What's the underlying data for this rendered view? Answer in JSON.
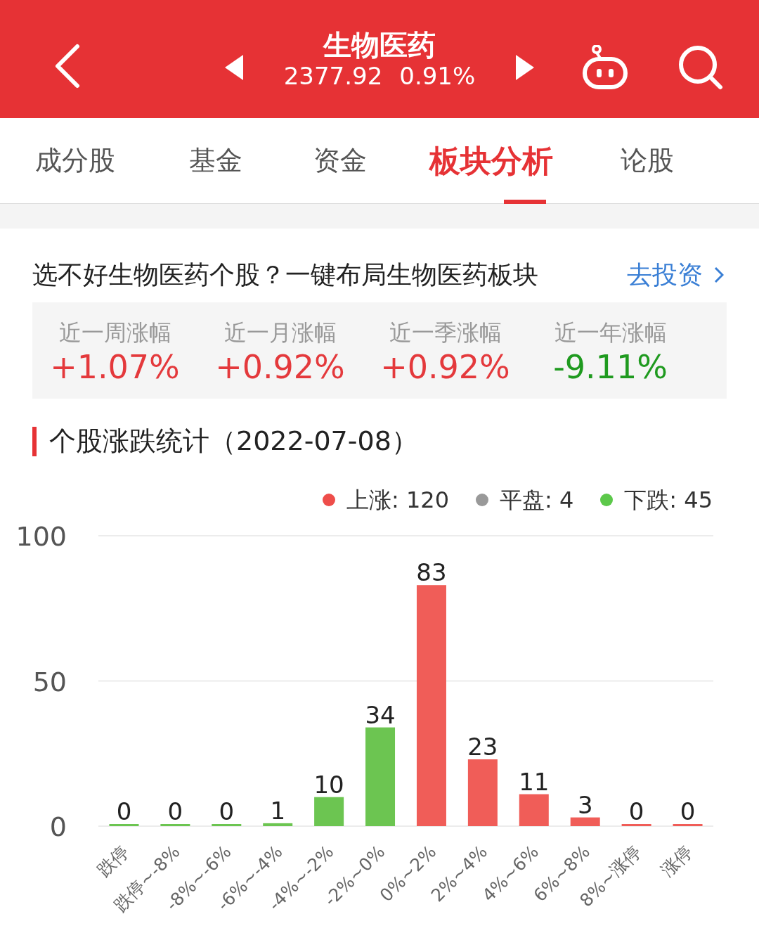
{
  "header": {
    "title": "生物医药",
    "index_value": "2377.92",
    "change": "0.91%"
  },
  "tabs": [
    {
      "label": "成分股",
      "selected": false
    },
    {
      "label": "基金",
      "selected": false
    },
    {
      "label": "资金",
      "selected": false
    },
    {
      "label": "板块分析",
      "selected": true
    },
    {
      "label": "论股",
      "selected": false
    }
  ],
  "promo": {
    "text": "选不好生物医药个股？一键布局生物医药板块",
    "link": "去投资"
  },
  "periods": [
    {
      "label": "近一周涨幅",
      "value": "+1.07%",
      "kind": "up"
    },
    {
      "label": "近一月涨幅",
      "value": "+0.92%",
      "kind": "up"
    },
    {
      "label": "近一季涨幅",
      "value": "+0.92%",
      "kind": "up"
    },
    {
      "label": "近一年涨幅",
      "value": "-9.11%",
      "kind": "down"
    }
  ],
  "section_title": "个股涨跌统计（2022-07-08）",
  "legend": [
    {
      "label": "上涨: 120",
      "color": "#ee4d4a"
    },
    {
      "label": "平盘: 4",
      "color": "#999999"
    },
    {
      "label": "下跌: 45",
      "color": "#5cc84a"
    }
  ],
  "chart_data": {
    "type": "bar",
    "categories": [
      "跌停",
      "跌停~-8%",
      "-8%~-6%",
      "-6%~-4%",
      "-4%~-2%",
      "-2%~0%",
      "0%~2%",
      "2%~4%",
      "4%~6%",
      "6%~8%",
      "8%~涨停",
      "涨停"
    ],
    "series": [
      {
        "color": "#6cc551",
        "values": [
          0,
          0,
          0,
          1,
          10,
          34,
          null,
          null,
          null,
          null,
          null,
          null
        ]
      },
      {
        "color": "#f05d58",
        "values": [
          null,
          null,
          null,
          null,
          null,
          null,
          83,
          23,
          11,
          3,
          0,
          0
        ]
      }
    ],
    "ylim": [
      0,
      100
    ],
    "yticks": [
      0,
      50,
      100
    ],
    "stacked": true,
    "data_labels": true
  }
}
